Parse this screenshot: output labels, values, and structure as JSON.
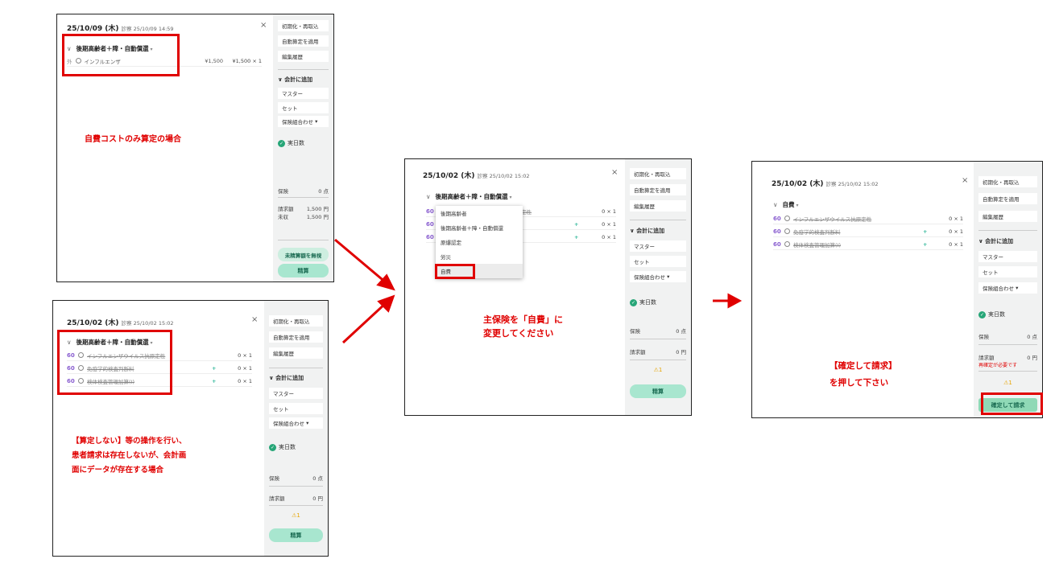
{
  "common": {
    "reset_btn": "初期化・再取込",
    "auto_btn": "自動算定を適用",
    "history_btn": "編集履歴",
    "add_section": "会計に追加",
    "master": "マスター",
    "set": "セット",
    "combo": "保険組合わせ",
    "actual_days": "実日数",
    "insurance": "保険",
    "billed": "請求額",
    "settle": "精算",
    "close_icon": "×",
    "warning": "⚠1"
  },
  "panel1": {
    "date": "25/10/09 (木)",
    "exam": "診察 25/10/09 14:59",
    "insurance": "後期高齢者＋障・自動償還",
    "item_prefix": "外",
    "item_name": "インフルエンザ",
    "item_amount": "¥1,500",
    "item_qty": "¥1,500 × 1",
    "insurance_val": "0 点",
    "billed_val": "1,500 円",
    "unpaid": "未収",
    "unpaid_val": "1,500 円",
    "ignore_btn": "未精算額を無視",
    "caption": "自費コストのみ算定の場合"
  },
  "panel2": {
    "date": "25/10/02 (木)",
    "exam": "診察 25/10/02 15:02",
    "insurance": "後期高齢者＋障・自動償還",
    "items": [
      {
        "code": "60",
        "name": "インフルエンザウイルス抗原定性",
        "qty": "0 × 1"
      },
      {
        "code": "60",
        "name": "免疫学的検査判断料",
        "qty": "0 × 1"
      },
      {
        "code": "60",
        "name": "検体検査管理加算(I)",
        "qty": "0 × 1"
      }
    ],
    "insurance_val": "0 点",
    "billed_val": "0 円",
    "caption": [
      "【算定しない】等の操作を行い、",
      "患者請求は存在しないが、会計画",
      "面にデータが存在する場合"
    ]
  },
  "panel3": {
    "date": "25/10/02 (木)",
    "exam": "診察 25/10/02 15:02",
    "insurance": "後期高齢者＋障・自動償還",
    "items": [
      {
        "code": "60",
        "name": "定性",
        "qty": "0 × 1"
      },
      {
        "code": "60",
        "name": "",
        "qty": "0 × 1"
      },
      {
        "code": "60",
        "name": "",
        "qty": "0 × 1"
      }
    ],
    "dropdown": [
      "後期高齢者",
      "後期高齢者＋障・自動償還",
      "原爆認定",
      "労災",
      "自費"
    ],
    "insurance_val": "0 点",
    "billed_val": "0 円",
    "bubble": [
      "主保険を「自費」に",
      "変更してください"
    ]
  },
  "panel4": {
    "date": "25/10/02 (木)",
    "exam": "診察 25/10/02 15:02",
    "insurance": "自費",
    "items": [
      {
        "code": "60",
        "name": "インフルエンザウイルス抗原定性",
        "qty": "0 × 1"
      },
      {
        "code": "60",
        "name": "免疫学的検査判断料",
        "qty": "0 × 1"
      },
      {
        "code": "60",
        "name": "検体検査管理加算(I)",
        "qty": "0 × 1"
      }
    ],
    "insurance_val": "0 点",
    "billed_val": "0 円",
    "reconfirm": "再確定が必要です",
    "confirm_btn": "確定して請求",
    "bubble": [
      "【確定して請求】",
      "を押して下さい"
    ]
  },
  "colors": {
    "highlight": "#e00000",
    "accent_green": "#a8e6cf",
    "code_purple": "#8a5fd0"
  }
}
